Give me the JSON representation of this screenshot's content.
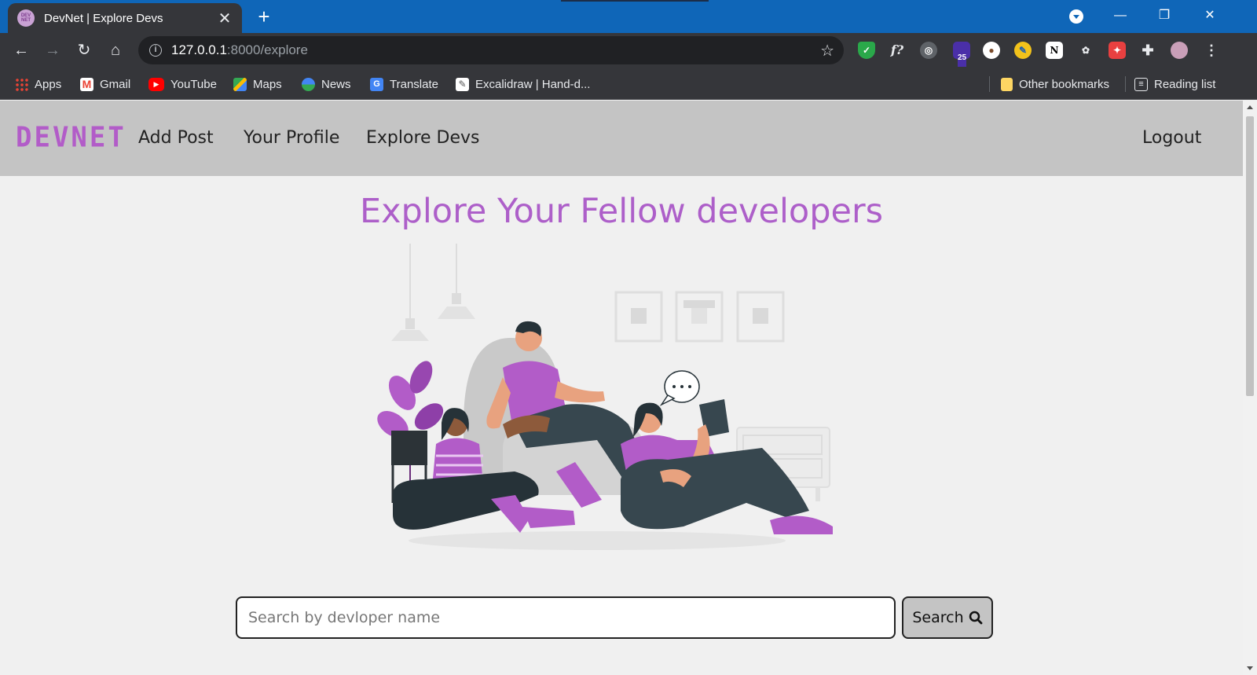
{
  "browser": {
    "tab_title": "DevNet | Explore Devs",
    "favicon_text": "DEV NET",
    "url_host": "127.0.0.1",
    "url_rest": ":8000/explore",
    "bookmarks": [
      {
        "label": "Apps",
        "icon": "apps-grid-icon"
      },
      {
        "label": "Gmail",
        "icon": "gmail-icon"
      },
      {
        "label": "YouTube",
        "icon": "youtube-icon"
      },
      {
        "label": "Maps",
        "icon": "maps-icon"
      },
      {
        "label": "News",
        "icon": "news-icon"
      },
      {
        "label": "Translate",
        "icon": "translate-icon"
      },
      {
        "label": "Excalidraw | Hand-d...",
        "icon": "excalidraw-icon"
      }
    ],
    "other_bookmarks": "Other bookmarks",
    "reading_list": "Reading list",
    "extension_badge": "25"
  },
  "site": {
    "brand": "DEVNET",
    "nav": {
      "add_post": "Add Post",
      "your_profile": "Your Profile",
      "explore_devs": "Explore Devs",
      "logout": "Logout"
    },
    "heading": "Explore Your Fellow developers",
    "search": {
      "placeholder": "Search by devloper name",
      "button_label": "Search"
    }
  },
  "colors": {
    "brand": "#b25cc8",
    "heading": "#ad5fc9",
    "navbar_bg": "#c4c4c4",
    "page_bg": "#f0f0f0",
    "chrome_tabbar": "#0f66b8",
    "chrome_toolbar": "#35363a"
  }
}
